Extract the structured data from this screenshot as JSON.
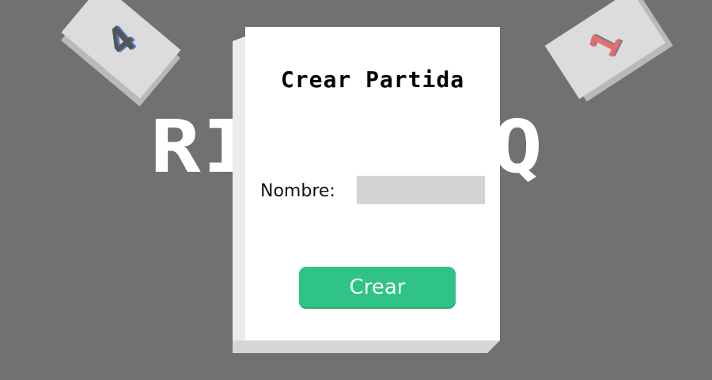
{
  "background": {
    "title_left": "RI",
    "title_right": "Q",
    "color": "#717171"
  },
  "cards": [
    {
      "value": "4",
      "color": "#555555",
      "outline_color": "#4a7dc9"
    },
    {
      "value": "1",
      "color": "#e46d72",
      "outline_color": "#7a7a7a"
    }
  ],
  "dialog": {
    "title": "Crear Partida",
    "name_label": "Nombre:",
    "name_value": "",
    "name_placeholder": "",
    "create_label": "Crear",
    "accent_color": "#2fc386"
  }
}
